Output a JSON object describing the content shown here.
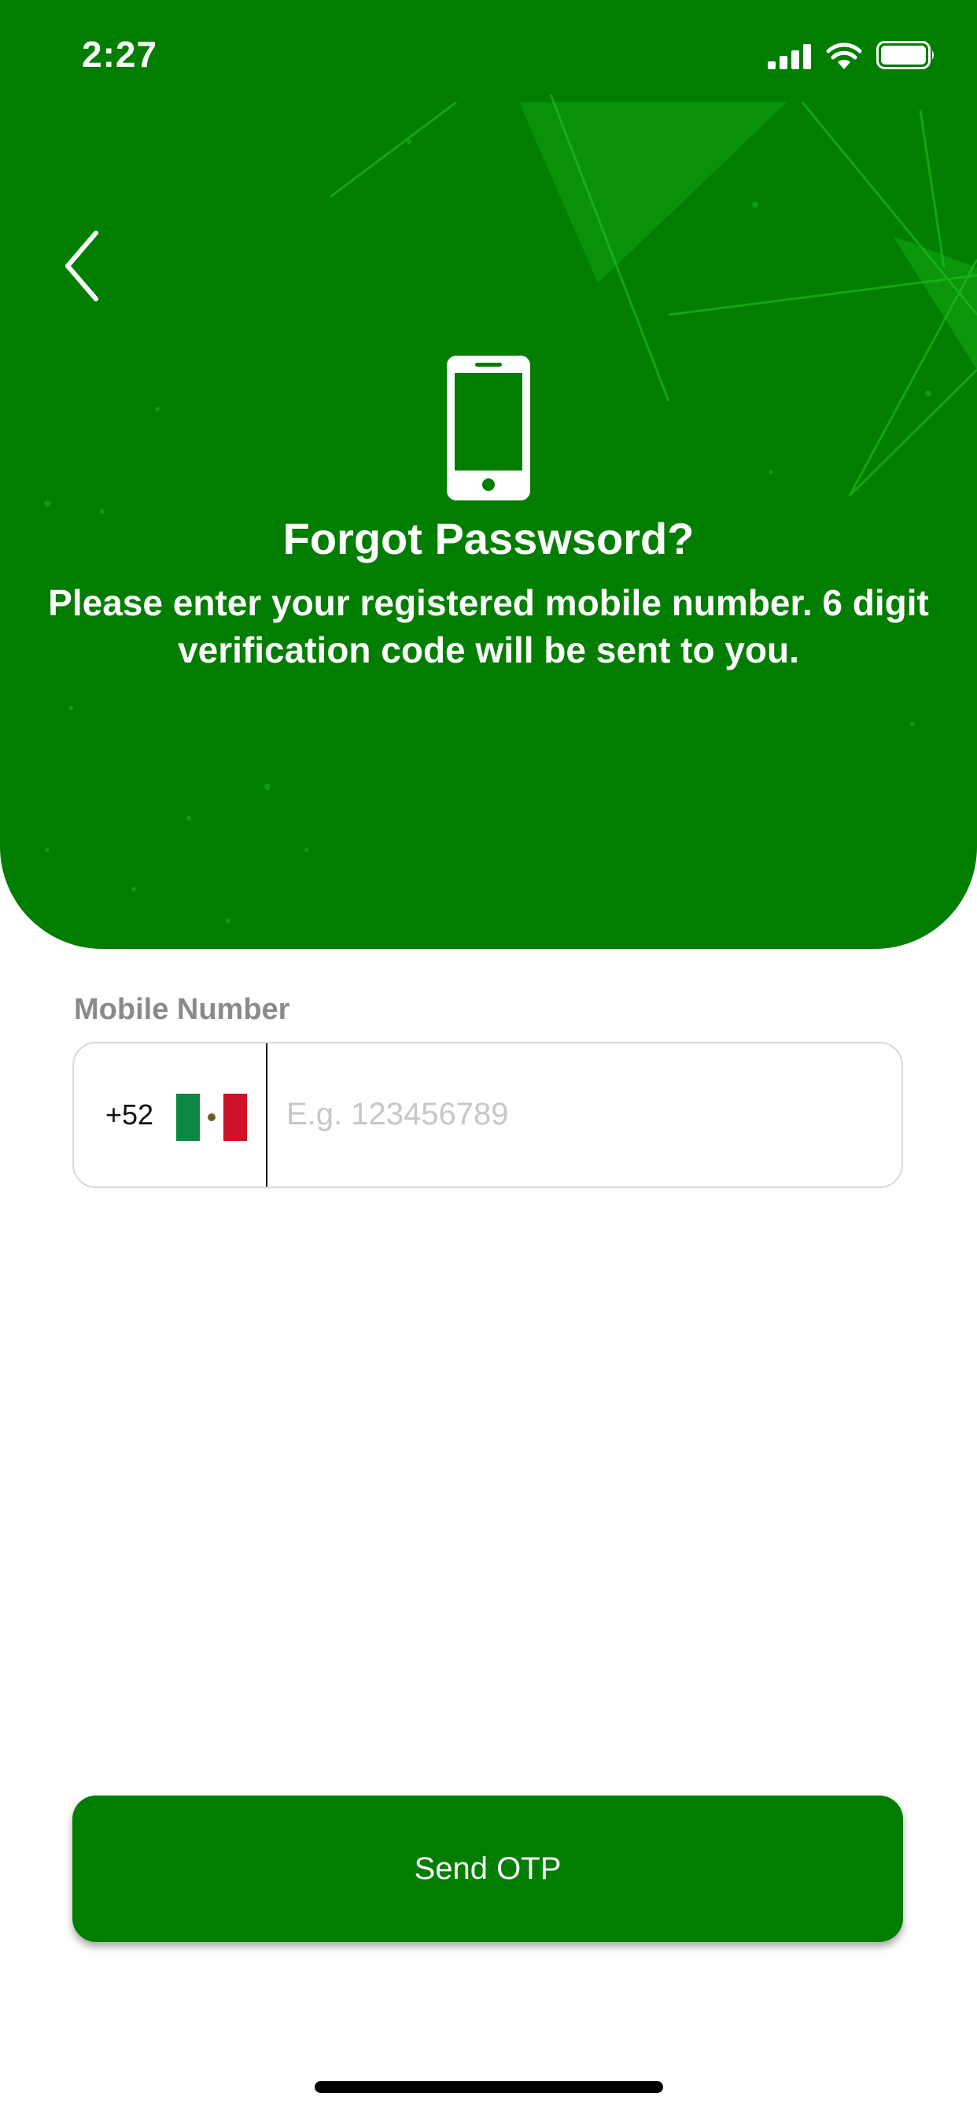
{
  "status_bar": {
    "time": "2:27",
    "icons": [
      "signal-icon",
      "wifi-icon",
      "battery-icon"
    ]
  },
  "header": {
    "back_icon": "chevron-left-icon",
    "illustration_icon": "smartphone-icon",
    "title": "Forgot Passwsord?",
    "subtitle": "Please enter your registered mobile number. 6 digit verification code will be sent to you."
  },
  "form": {
    "mobile_label": "Mobile Number",
    "country_code": "+52",
    "country_flag": "mexico-flag-icon",
    "phone_placeholder": "E.g. 123456789",
    "phone_value": ""
  },
  "actions": {
    "send_label": "Send OTP"
  },
  "colors": {
    "primary_green": "#017d00",
    "button_text": "#ffffff",
    "label_gray": "#8a8a8a",
    "placeholder_gray": "#c7c7c7"
  }
}
